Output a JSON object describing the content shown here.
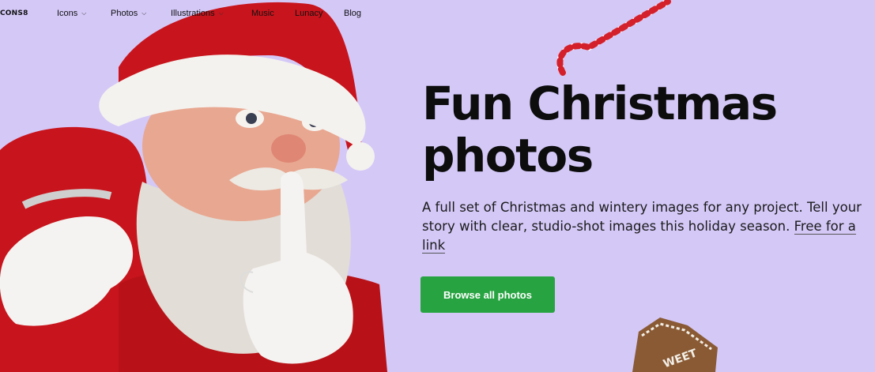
{
  "nav": {
    "logo": "CONS8",
    "items": [
      {
        "label": "Icons",
        "dropdown": true
      },
      {
        "label": "Photos",
        "dropdown": true
      },
      {
        "label": "Illustrations",
        "dropdown": true
      },
      {
        "label": "Music",
        "dropdown": false
      },
      {
        "label": "Lunacy",
        "dropdown": false
      },
      {
        "label": "Blog",
        "dropdown": false
      }
    ]
  },
  "hero": {
    "headline": "Fun Christmas photos",
    "description": "A full set of Christmas and wintery images for any project. Tell your story with clear, studio-shot images this holiday season.",
    "link_label": "Free for a link",
    "cta_label": "Browse all photos",
    "cookie_text": "WEET"
  },
  "colors": {
    "background": "#d4c8f7",
    "cta": "#27a441",
    "santa_red": "#c8141c"
  }
}
